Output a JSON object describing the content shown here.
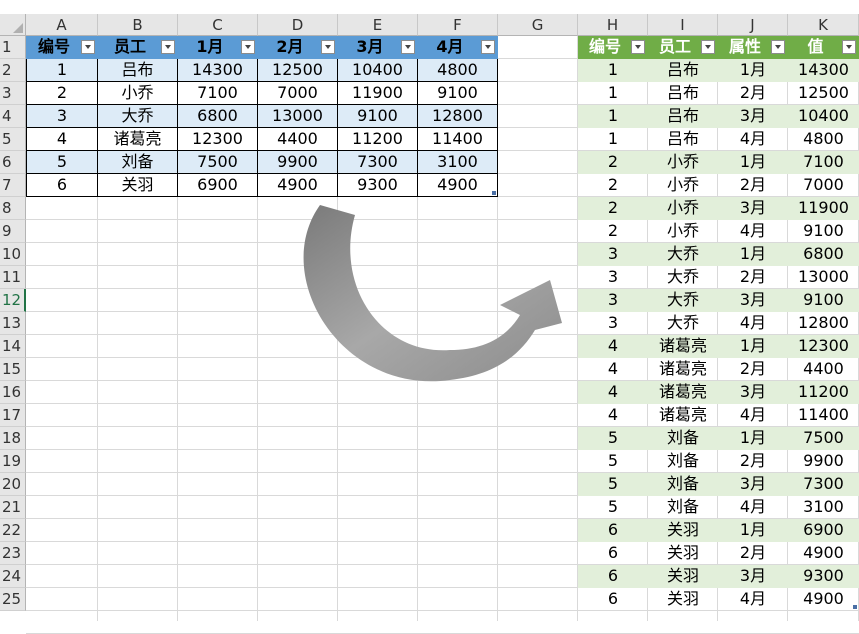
{
  "columns": [
    "A",
    "B",
    "C",
    "D",
    "E",
    "F",
    "G",
    "H",
    "I",
    "J",
    "K"
  ],
  "rows": [
    "1",
    "2",
    "3",
    "4",
    "5",
    "6",
    "7",
    "8",
    "9",
    "10",
    "11",
    "12",
    "13",
    "14",
    "15",
    "16",
    "17",
    "18",
    "19",
    "20",
    "21",
    "22",
    "23",
    "24",
    "25"
  ],
  "selected_row": "12",
  "left_table": {
    "headers": [
      "编号",
      "员工",
      "1月",
      "2月",
      "3月",
      "4月"
    ],
    "rows": [
      [
        "1",
        "吕布",
        "14300",
        "12500",
        "10400",
        "4800"
      ],
      [
        "2",
        "小乔",
        "7100",
        "7000",
        "11900",
        "9100"
      ],
      [
        "3",
        "大乔",
        "6800",
        "13000",
        "9100",
        "12800"
      ],
      [
        "4",
        "诸葛亮",
        "12300",
        "4400",
        "11200",
        "11400"
      ],
      [
        "5",
        "刘备",
        "7500",
        "9900",
        "7300",
        "3100"
      ],
      [
        "6",
        "关羽",
        "6900",
        "4900",
        "9300",
        "4900"
      ]
    ],
    "header_color": "#5b9bd5",
    "band_color": "#ddebf7"
  },
  "right_table": {
    "headers": [
      "编号",
      "员工",
      "属性",
      "值"
    ],
    "rows": [
      [
        "1",
        "吕布",
        "1月",
        "14300"
      ],
      [
        "1",
        "吕布",
        "2月",
        "12500"
      ],
      [
        "1",
        "吕布",
        "3月",
        "10400"
      ],
      [
        "1",
        "吕布",
        "4月",
        "4800"
      ],
      [
        "2",
        "小乔",
        "1月",
        "7100"
      ],
      [
        "2",
        "小乔",
        "2月",
        "7000"
      ],
      [
        "2",
        "小乔",
        "3月",
        "11900"
      ],
      [
        "2",
        "小乔",
        "4月",
        "9100"
      ],
      [
        "3",
        "大乔",
        "1月",
        "6800"
      ],
      [
        "3",
        "大乔",
        "2月",
        "13000"
      ],
      [
        "3",
        "大乔",
        "3月",
        "9100"
      ],
      [
        "3",
        "大乔",
        "4月",
        "12800"
      ],
      [
        "4",
        "诸葛亮",
        "1月",
        "12300"
      ],
      [
        "4",
        "诸葛亮",
        "2月",
        "4400"
      ],
      [
        "4",
        "诸葛亮",
        "3月",
        "11200"
      ],
      [
        "4",
        "诸葛亮",
        "4月",
        "11400"
      ],
      [
        "5",
        "刘备",
        "1月",
        "7500"
      ],
      [
        "5",
        "刘备",
        "2月",
        "9900"
      ],
      [
        "5",
        "刘备",
        "3月",
        "7300"
      ],
      [
        "5",
        "刘备",
        "4月",
        "3100"
      ],
      [
        "6",
        "关羽",
        "1月",
        "6900"
      ],
      [
        "6",
        "关羽",
        "2月",
        "4900"
      ],
      [
        "6",
        "关羽",
        "3月",
        "9300"
      ],
      [
        "6",
        "关羽",
        "4月",
        "4900"
      ]
    ],
    "header_color": "#70ad47",
    "band_color": "#e2efda"
  },
  "arrow_icon": "curved-arrow-icon"
}
